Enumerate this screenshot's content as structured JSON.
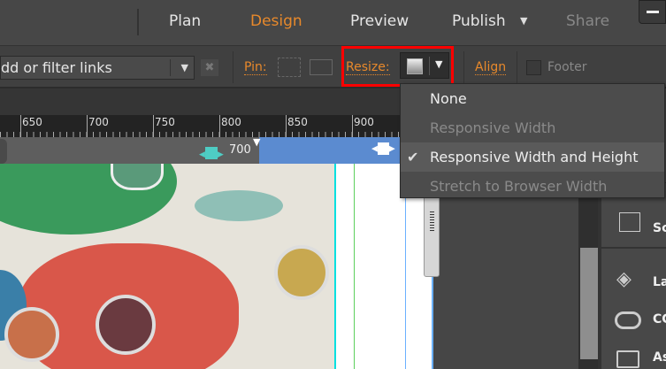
{
  "nav": {
    "plan": "Plan",
    "design": "Design",
    "preview": "Preview",
    "publish": "Publish",
    "share": "Share"
  },
  "toolbar": {
    "links_placeholder": "dd or filter links",
    "pin_label": "Pin:",
    "resize_label": "Resize:",
    "align_label": "Align",
    "footer_label": "Footer"
  },
  "ruler": {
    "ticks": [
      "650",
      "700",
      "750",
      "800",
      "850",
      "900"
    ]
  },
  "breakpoint": {
    "width_value": "700"
  },
  "resize_menu": {
    "items": [
      {
        "label": "None",
        "enabled": true,
        "checked": false
      },
      {
        "label": "Responsive Width",
        "enabled": false,
        "checked": false
      },
      {
        "label": "Responsive Width and Height",
        "enabled": true,
        "checked": true
      },
      {
        "label": "Stretch to Browser Width",
        "enabled": false,
        "checked": false
      }
    ]
  },
  "right_panel": {
    "items": [
      "Sc",
      "La",
      "CC",
      "As"
    ]
  },
  "colors": {
    "accent": "#e8892b",
    "highlight": "#ff0000",
    "breakpoint": "#5b8bd0"
  }
}
